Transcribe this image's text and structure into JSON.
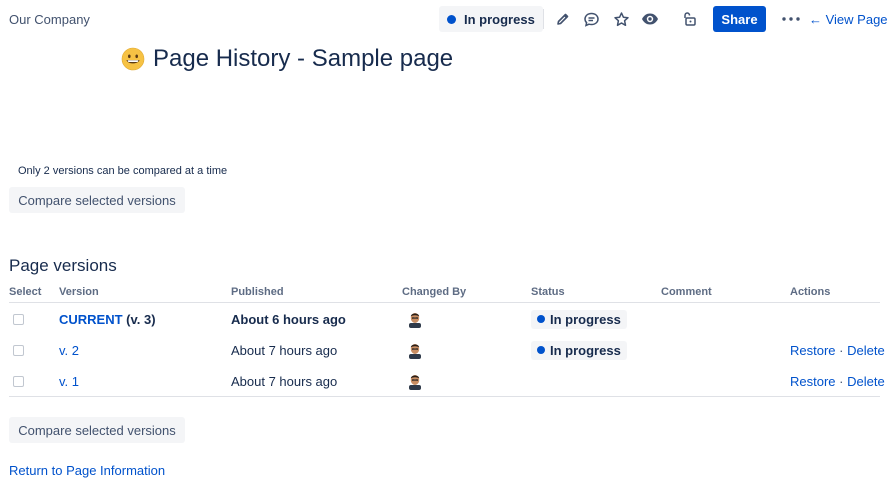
{
  "header": {
    "breadcrumb": "Our Company",
    "status_label": "In progress",
    "share_label": "Share",
    "view_page_label": "← View Page",
    "icons": [
      "edit-icon",
      "comment-icon",
      "star-icon",
      "watch-icon",
      "restrictions-icon",
      "more-icon"
    ]
  },
  "page": {
    "title": "Page History - Sample page",
    "emoji": "grinning-face-emoji"
  },
  "compare": {
    "note": "Only 2 versions can be compared at a time",
    "button_label": "Compare selected versions"
  },
  "versions": {
    "section_title": "Page versions",
    "columns": [
      "Select",
      "Version",
      "Published",
      "Changed By",
      "Status",
      "Comment",
      "Actions"
    ],
    "rows": [
      {
        "version_link": "CURRENT",
        "version_suffix": " (v. 3)",
        "published": "About 6 hours ago",
        "status": "In progress",
        "comment": "",
        "restore": "",
        "delete": ""
      },
      {
        "version_link": "v. 2",
        "version_suffix": "",
        "published": "About 7 hours ago",
        "status": "In progress",
        "comment": "",
        "restore": "Restore",
        "delete": "Delete"
      },
      {
        "version_link": "v. 1",
        "version_suffix": "",
        "published": "About 7 hours ago",
        "status": "",
        "comment": "",
        "restore": "Restore",
        "delete": "Delete"
      }
    ],
    "action_separator": " · "
  },
  "footer": {
    "return_link": "Return to Page Information"
  },
  "colors": {
    "accent": "#0052cc",
    "text": "#172b4d",
    "lozenge_bg": "#f4f5f7"
  }
}
